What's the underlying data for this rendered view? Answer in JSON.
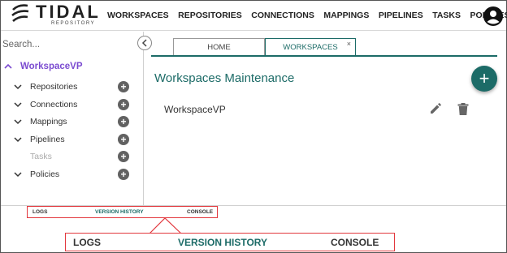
{
  "header": {
    "logo_text": "TIDAL",
    "logo_sub": "REPOSITORY",
    "nav": [
      "WORKSPACES",
      "REPOSITORIES",
      "CONNECTIONS",
      "MAPPINGS",
      "PIPELINES",
      "TASKS",
      "POLICIES"
    ],
    "account_icon": "account-circle-icon"
  },
  "sidebar": {
    "search_placeholder": "Search...",
    "workspace": "WorkspaceVP",
    "items": [
      {
        "label": "Repositories",
        "expandable": true,
        "enabled": true
      },
      {
        "label": "Connections",
        "expandable": true,
        "enabled": true
      },
      {
        "label": "Mappings",
        "expandable": true,
        "enabled": true
      },
      {
        "label": "Pipelines",
        "expandable": true,
        "enabled": true
      },
      {
        "label": "Tasks",
        "expandable": false,
        "enabled": false
      },
      {
        "label": "Policies",
        "expandable": true,
        "enabled": true
      }
    ]
  },
  "tabs": {
    "home": "HOME",
    "workspaces": "WORKSPACES",
    "close": "×"
  },
  "main": {
    "title": "Workspaces Maintenance",
    "add": "+",
    "rows": [
      {
        "name": "WorkspaceVP"
      }
    ]
  },
  "bottom": {
    "logs": "LOGS",
    "version_history": "VERSION HISTORY",
    "console": "CONSOLE"
  },
  "colors": {
    "accent": "#1c6b67",
    "workspace": "#7b4bd0",
    "callout": "#e2373d"
  }
}
